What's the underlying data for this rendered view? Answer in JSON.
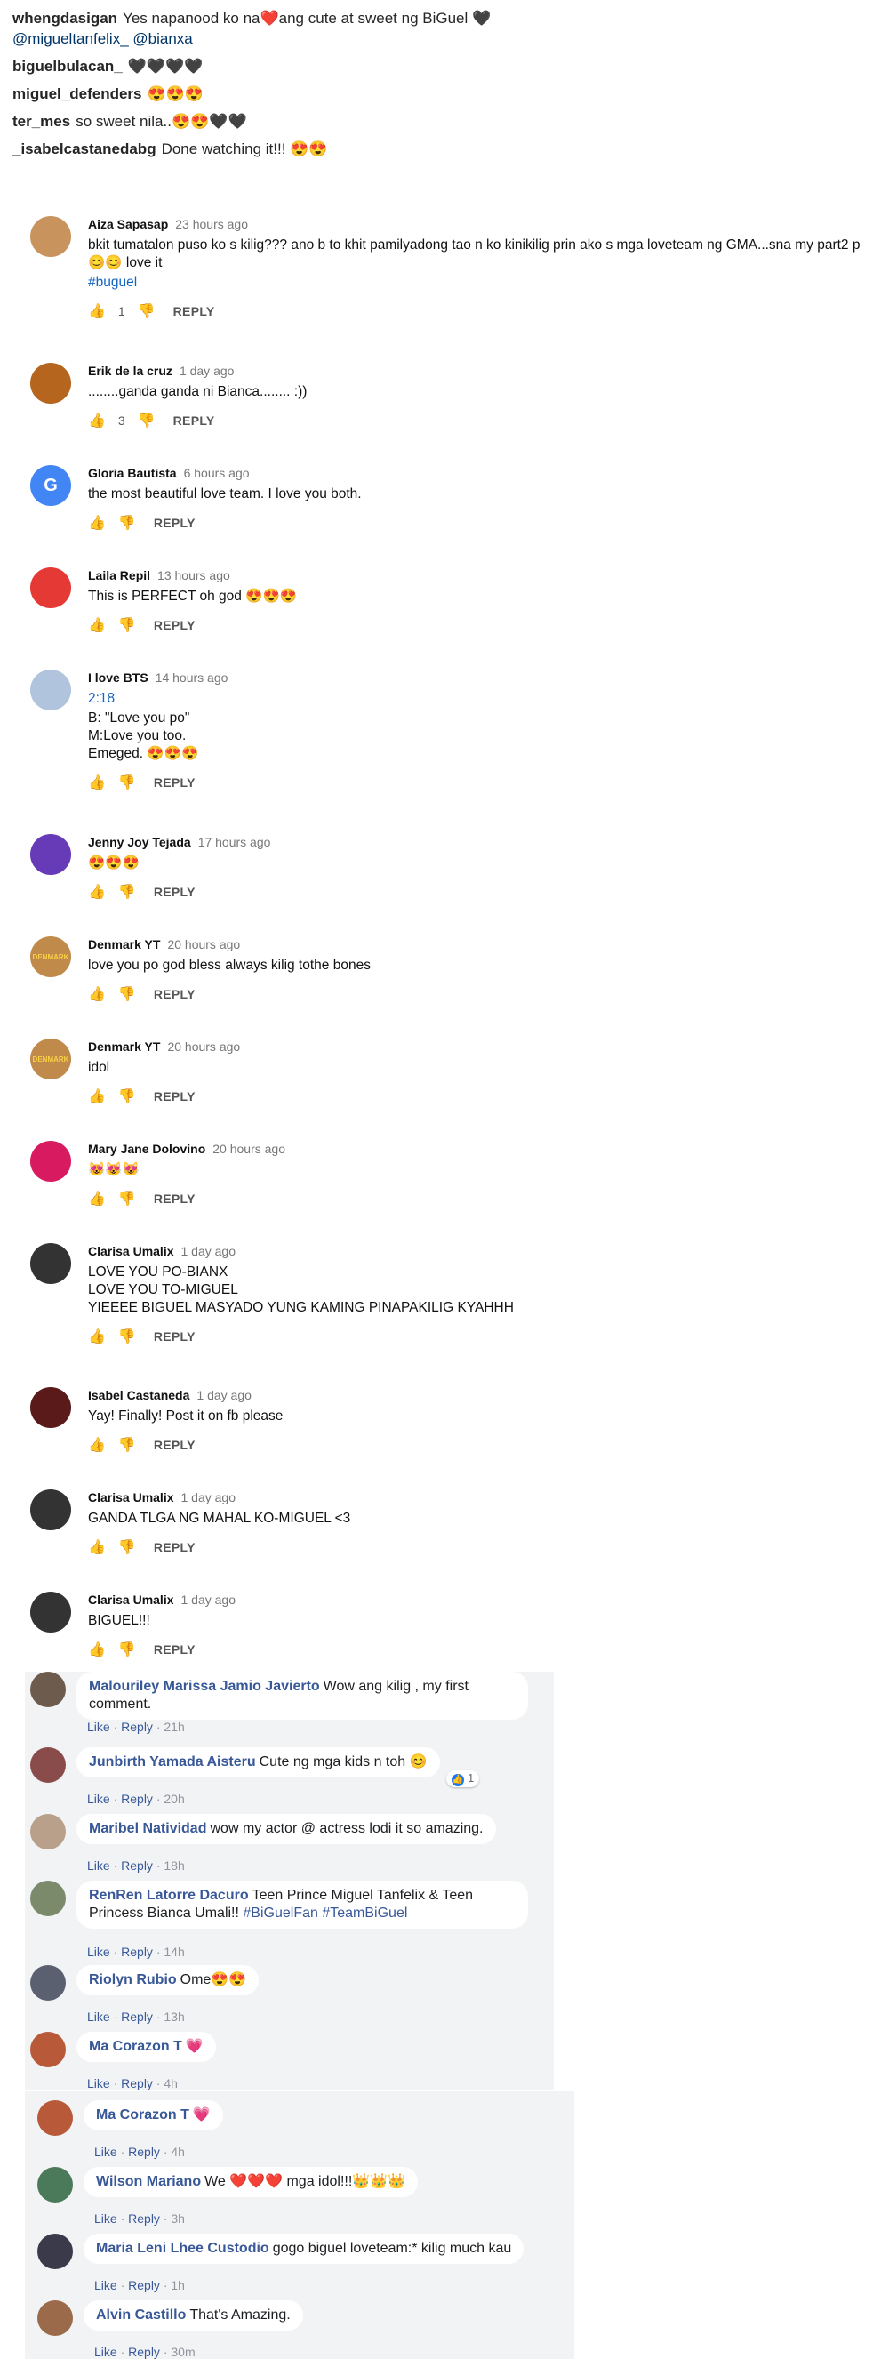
{
  "instagram": {
    "rows": [
      {
        "user": "whengdasigan",
        "text": "Yes napanood ko na❤️ang cute at sweet ng BiGuel 🖤 ",
        "mentions": "@migueltanfelix_ @bianxa"
      },
      {
        "user": "biguelbulacan_",
        "text": "🖤🖤🖤🖤"
      },
      {
        "user": "miguel_defenders",
        "text": "😍😍😍"
      },
      {
        "user": "ter_mes",
        "text": "so sweet nila..😍😍🖤🖤"
      },
      {
        "user": "_isabelcastanedabg",
        "text": "Done watching it!!! 😍😍"
      }
    ]
  },
  "youtube": {
    "reply_label": "REPLY",
    "comments": [
      {
        "name": "Aiza Sapasap",
        "time": "23 hours ago",
        "text": "bkit tumatalon puso ko s kilig??? ano b to khit pamilyadong tao n ko kinikilig prin ako s mga loveteam ng GMA...sna my part2 p😊😊 love it",
        "link": "#buguel",
        "likes": "1",
        "avatar_color": "#c9935e"
      },
      {
        "name": "Erik de la cruz",
        "time": "1 day ago",
        "text": "........ganda ganda ni Bianca........ :))",
        "likes": "3",
        "avatar_color": "#b5651d"
      },
      {
        "name": "Gloria Bautista",
        "time": "6 hours ago",
        "text": "the most beautiful love team. I love you both.",
        "likes": "",
        "avatar_color": "#4285f4",
        "avatar_letter": "G"
      },
      {
        "name": "Laila Repil",
        "time": "13 hours ago",
        "text": "This is PERFECT oh god 😍😍😍",
        "likes": "",
        "avatar_color": "#e53935"
      },
      {
        "name": "I love BTS",
        "time": "14 hours ago",
        "link_top": "2:18",
        "text": "B: \"Love you po\"\nM:Love you too.\nEmeged. 😍😍😍",
        "likes": "",
        "avatar_color": "#b0c4de"
      },
      {
        "name": "Jenny Joy Tejada",
        "time": "17 hours ago",
        "text": "😍😍😍",
        "likes": "",
        "avatar_color": "#673ab7"
      },
      {
        "name": "Denmark YT",
        "time": "20 hours ago",
        "text": "love you po god bless always kilig tothe bones",
        "likes": "",
        "avatar_color": "#c08a4a",
        "avatar_letter": "DENMARK"
      },
      {
        "name": "Denmark YT",
        "time": "20 hours ago",
        "text": "idol",
        "likes": "",
        "avatar_color": "#c08a4a",
        "avatar_letter": "DENMARK"
      },
      {
        "name": "Mary Jane Dolovino",
        "time": "20 hours ago",
        "text": "😻😻😻",
        "likes": "",
        "avatar_color": "#d81b60"
      },
      {
        "name": "Clarisa Umalix",
        "time": "1 day ago",
        "text": "LOVE YOU PO-BIANX\nLOVE YOU TO-MIGUEL\nYIEEEE BIGUEL MASYADO YUNG KAMING PINAPAKILIG KYAHHH",
        "likes": "",
        "avatar_color": "#333333"
      },
      {
        "name": "Isabel Castaneda",
        "time": "1 day ago",
        "text": "Yay! Finally! Post it on fb please",
        "likes": "",
        "avatar_color": "#5a1a1a"
      },
      {
        "name": "Clarisa Umalix",
        "time": "1 day ago",
        "text": "GANDA TLGA NG MAHAL KO-MIGUEL <3",
        "likes": "",
        "avatar_color": "#333333"
      },
      {
        "name": "Clarisa Umalix",
        "time": "1 day ago",
        "text": "BIGUEL!!!",
        "likes": "",
        "avatar_color": "#333333"
      }
    ]
  },
  "facebook": {
    "like_label": "Like",
    "reply_label": "Reply",
    "comments": [
      {
        "name": "Malouriley Marissa Jamio Javierto",
        "text": "Wow ang kilig , my first comment.",
        "time": "21h",
        "avatar_color": "#6d5c4d"
      },
      {
        "name": "Junbirth Yamada Aisteru",
        "text": "Cute ng mga kids n toh 😊",
        "time": "20h",
        "avatar_color": "#8a4b4b",
        "reaction": "1"
      },
      {
        "name": "Maribel Natividad",
        "text": "wow my actor @ actress lodi it so amazing.",
        "time": "18h",
        "avatar_color": "#b8a08a"
      },
      {
        "name": "RenRen Latorre Dacuro",
        "text": "Teen Prince Miguel Tanfelix & Teen Princess Bianca Umali!!",
        "tags": "#BiGuelFan #TeamBiGuel",
        "time": "14h",
        "avatar_color": "#7a8a6a"
      },
      {
        "name": "Riolyn Rubio",
        "text": "Ome😍😍",
        "time": "13h",
        "avatar_color": "#5a6070"
      },
      {
        "name": "Ma Corazon T",
        "text": "💗",
        "time": "4h",
        "avatar_color": "#b85a3a"
      },
      {
        "name": "Ma Corazon T",
        "text": "💗",
        "time": "4h",
        "avatar_color": "#b85a3a"
      },
      {
        "name": "Wilson Mariano",
        "text": "We ❤️❤️❤️ mga idol!!!👑👑👑",
        "time": "3h",
        "avatar_color": "#4a7a5a"
      },
      {
        "name": "Maria Leni Lhee Custodio",
        "text": "gogo biguel loveteam:* kilig much kau",
        "time": "1h",
        "avatar_color": "#3a3a4a"
      },
      {
        "name": "Alvin Castillo",
        "text": "That's Amazing.",
        "time": "30m",
        "avatar_color": "#9a6a4a"
      }
    ]
  }
}
